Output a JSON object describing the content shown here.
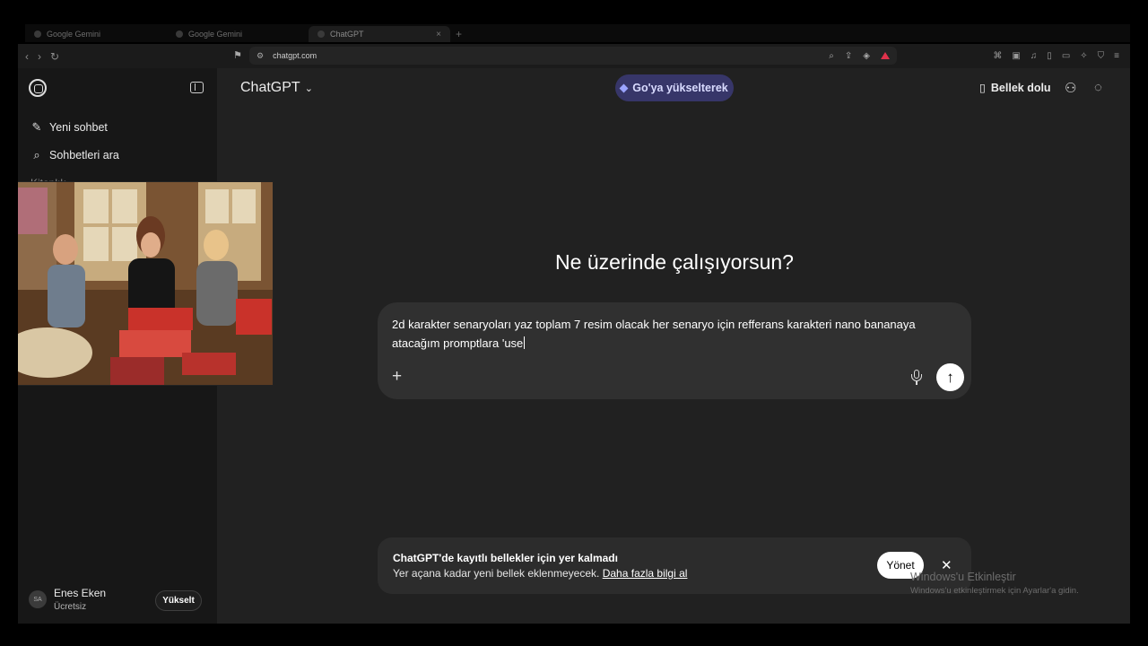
{
  "browser": {
    "tabs": [
      {
        "label": "Google Gemini",
        "active": false
      },
      {
        "label": "Google Gemini",
        "active": false
      },
      {
        "label": "ChatGPT",
        "active": true
      }
    ],
    "url": "chatgpt.com"
  },
  "sidebar": {
    "new_chat": "Yeni sohbet",
    "search_chats": "Sohbetleri ara",
    "faded_item": "Kitaplık",
    "user_initials": "SA",
    "user_name": "Enes Eken",
    "user_plan": "Ücretsiz",
    "upgrade_label": "Yükselt"
  },
  "header": {
    "model": "ChatGPT",
    "go_upgrade": "Go'ya yükselterek",
    "memory_full": "Bellek dolu"
  },
  "main": {
    "heading": "Ne üzerinde çalışıyorsun?",
    "prompt_text": "2d karakter senaryoları yaz toplam 7 resim olacak her senaryo için refferans karakteri nano bananaya atacağım promptlara 'use"
  },
  "banner": {
    "title": "ChatGPT'de kayıtlı bellekler için yer kalmadı",
    "body": "Yer açana kadar yeni bellek eklenmeyecek.",
    "link": "Daha fazla bilgi al",
    "manage_label": "Yönet"
  },
  "watermark": {
    "title": "Windows'u Etkinleştir",
    "subtitle": "Windows'u etkinleştirmek için Ayarlar'a gidin."
  },
  "colors": {
    "app_bg": "#212121",
    "sidebar_bg": "#171717",
    "go_button": "#373669",
    "composer_bg": "#303030"
  }
}
